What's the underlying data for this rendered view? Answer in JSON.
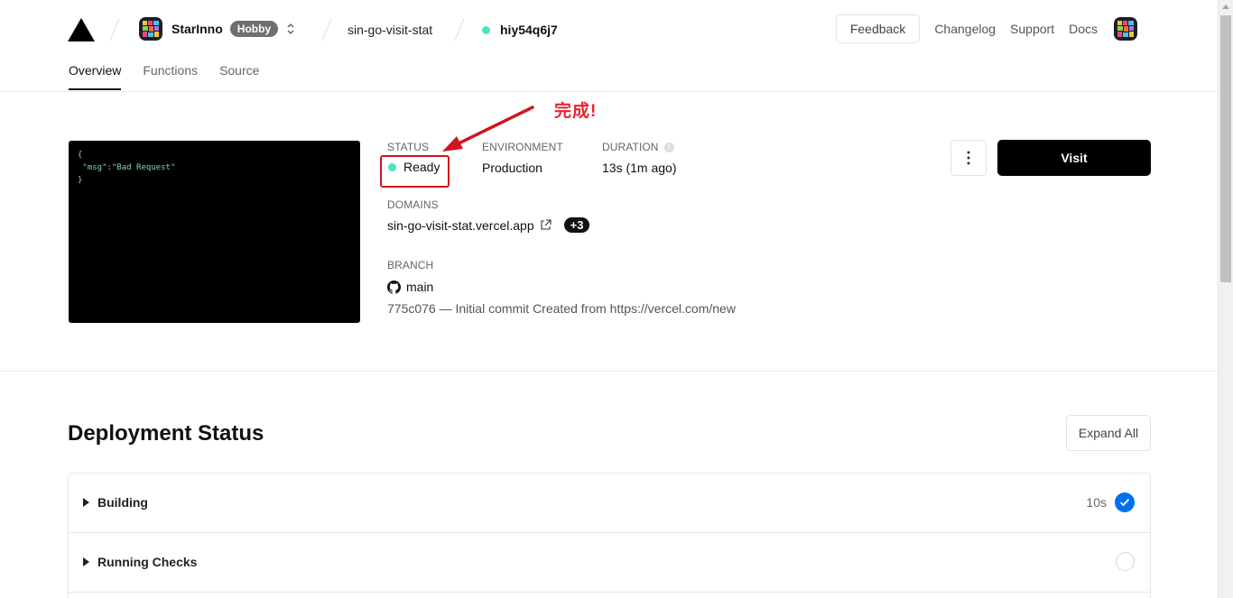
{
  "header": {
    "team": {
      "name": "StarInno",
      "plan": "Hobby"
    },
    "project": "sin-go-visit-stat",
    "deployment_id": "hiy54q6j7",
    "feedback_label": "Feedback",
    "links": [
      "Changelog",
      "Support",
      "Docs"
    ]
  },
  "tabs": [
    "Overview",
    "Functions",
    "Source"
  ],
  "preview": {
    "lines": [
      "{",
      " \"msg\":\"Bad Request\"",
      "}"
    ]
  },
  "overview": {
    "status_label": "STATUS",
    "status_value": "Ready",
    "environment_label": "ENVIRONMENT",
    "environment_value": "Production",
    "duration_label": "DURATION",
    "duration_value": "13s",
    "duration_ago": "(1m ago)",
    "domains_label": "DOMAINS",
    "domain": "sin-go-visit-stat.vercel.app",
    "domain_more": "+3",
    "branch_label": "BRANCH",
    "branch": "main",
    "commit": "775c076 — Initial commit Created from https://vercel.com/new",
    "visit_label": "Visit"
  },
  "annotation": {
    "text": "完成!"
  },
  "deployment_status": {
    "title": "Deployment Status",
    "expand_label": "Expand All",
    "rows": [
      {
        "label": "Building",
        "time": "10s",
        "done": true
      },
      {
        "label": "Running Checks",
        "time": "",
        "done": false
      }
    ]
  },
  "colors": {
    "accent_blue": "#0070f3",
    "ready_green": "#50e3c2",
    "annotation_red": "#d0151f"
  }
}
